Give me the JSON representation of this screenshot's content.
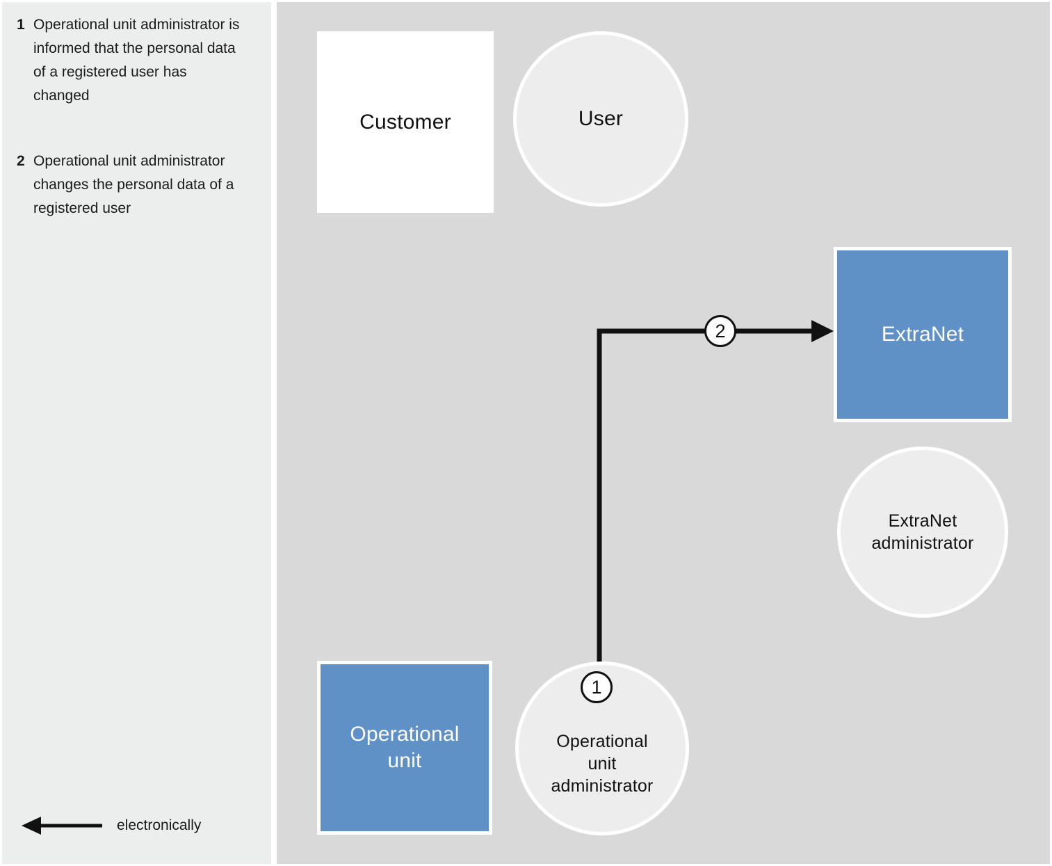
{
  "notes": [
    {
      "number": "1",
      "text": "Operational unit administrator is informed that the personal data of a registered user has changed"
    },
    {
      "number": "2",
      "text": "Operational unit administrator changes the personal data of a registered user"
    }
  ],
  "legend": {
    "arrow_icon": "left-arrow-icon",
    "label": "electronically"
  },
  "diagram": {
    "type": "flow-diagram",
    "nodes": [
      {
        "id": "customer",
        "label": "Customer",
        "shape": "rectangle",
        "fill": "#ffffff",
        "text_color": "#111111"
      },
      {
        "id": "user",
        "label": "User",
        "shape": "circle",
        "fill": "#ededed",
        "text_color": "#111111"
      },
      {
        "id": "extranet",
        "label": "ExtraNet",
        "shape": "rectangle",
        "fill": "#6091c6",
        "text_color": "#ffffff"
      },
      {
        "id": "extranet_admin",
        "label": "ExtraNet\nadministrator",
        "shape": "circle",
        "fill": "#ededed",
        "text_color": "#111111"
      },
      {
        "id": "operational_unit",
        "label": "Operational\nunit",
        "shape": "rectangle",
        "fill": "#6091c6",
        "text_color": "#ffffff"
      },
      {
        "id": "operational_unit_admin",
        "label": "Operational\nunit\nadministrator",
        "shape": "circle",
        "fill": "#ededed",
        "text_color": "#111111"
      }
    ],
    "steps": [
      {
        "number": "1",
        "attached_to": "operational_unit_admin"
      },
      {
        "number": "2",
        "from": "operational_unit_admin",
        "to": "extranet"
      }
    ]
  },
  "colors": {
    "panel_background": "#d9d9d9",
    "notes_background": "#eceeed",
    "accent_blue": "#6091c6",
    "circle_fill": "#ededed",
    "line": "#111111"
  }
}
